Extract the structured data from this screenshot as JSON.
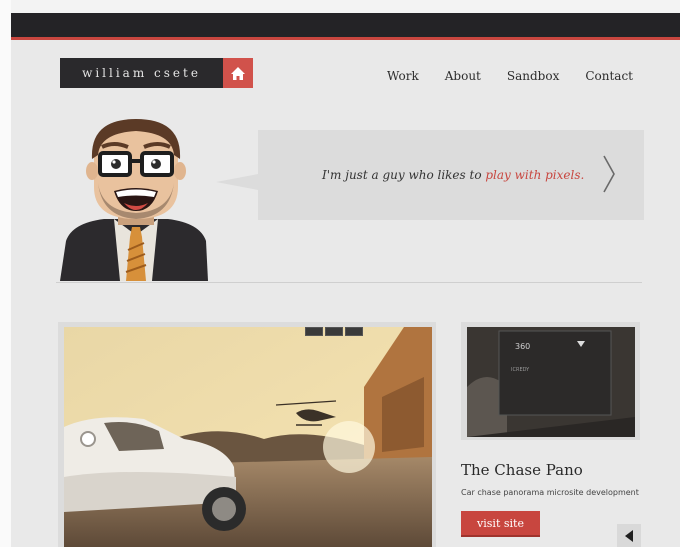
{
  "header": {
    "logo_text": "william csete",
    "home_icon": "home-icon"
  },
  "nav": {
    "items": [
      {
        "label": "Work"
      },
      {
        "label": "About"
      },
      {
        "label": "Sandbox"
      },
      {
        "label": "Contact"
      }
    ]
  },
  "intro": {
    "text_before": "I'm just a guy who likes to ",
    "text_highlight": "play with pixels.",
    "next_icon": "chevron-right-icon"
  },
  "hero": {
    "controls": [
      "",
      "",
      ""
    ]
  },
  "project": {
    "title": "The Chase Pano",
    "description": "Car chase panorama microsite development",
    "visit_label": "visit site",
    "thumb_label_left": "360",
    "thumb_label_right": "ICREDY",
    "prev_icon": "arrow-left-icon"
  },
  "colors": {
    "accent": "#c8463f",
    "dark": "#242326",
    "background": "#e9e9e9"
  }
}
